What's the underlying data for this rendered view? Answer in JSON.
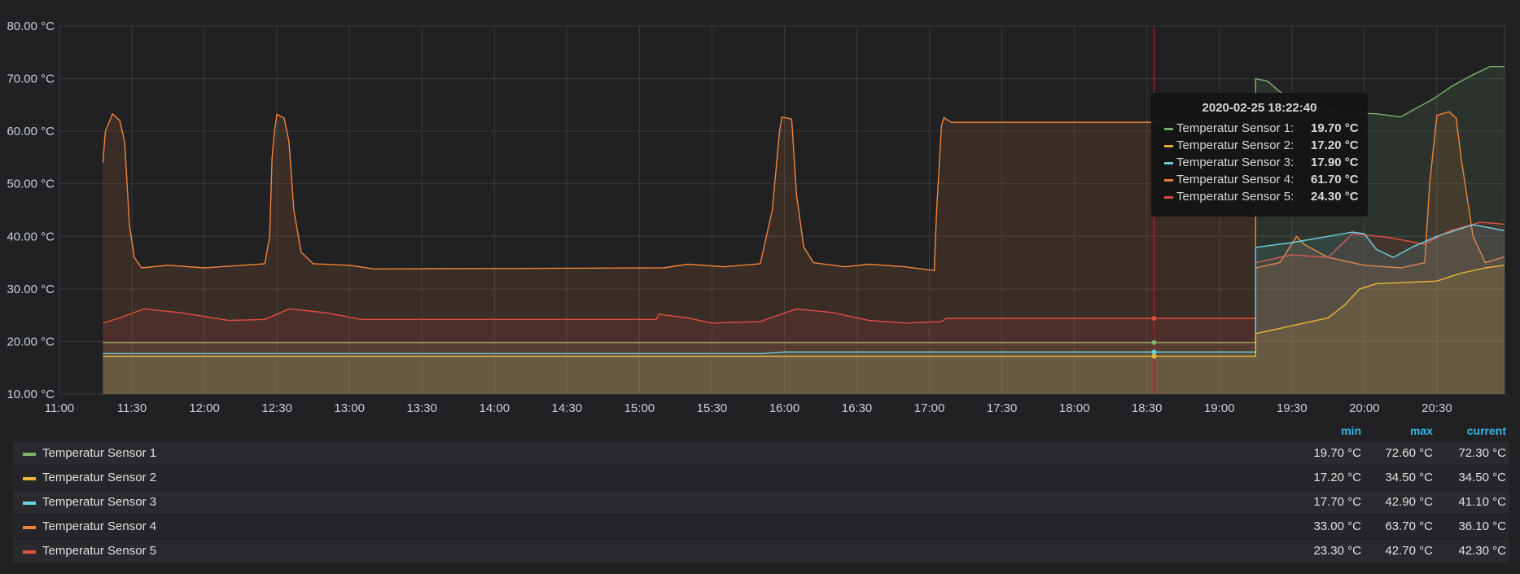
{
  "chart_data": {
    "type": "area",
    "title": "",
    "xlabel": "",
    "ylabel": "",
    "x_range": [
      "11:00",
      "20:58"
    ],
    "ylim": [
      10,
      80
    ],
    "y_ticks": [
      "80.00 °C",
      "70.00 °C",
      "60.00 °C",
      "50.00 °C",
      "40.00 °C",
      "30.00 °C",
      "20.00 °C",
      "10.00 °C"
    ],
    "x_ticks": [
      "11:00",
      "11:30",
      "12:00",
      "12:30",
      "13:00",
      "13:30",
      "14:00",
      "14:30",
      "15:00",
      "15:30",
      "16:00",
      "16:30",
      "17:00",
      "17:30",
      "18:00",
      "18:30",
      "19:00",
      "19:30",
      "20:00",
      "20:30"
    ],
    "grid": true,
    "cursor_time": "18:33",
    "series": [
      {
        "name": "Temperatur Sensor 1",
        "color": "#7eb26d",
        "points": [
          [
            "11:18",
            19.8
          ],
          [
            "19:15",
            19.8
          ],
          [
            "19:15",
            70.0
          ],
          [
            "19:20",
            69.5
          ],
          [
            "19:25",
            67.5
          ],
          [
            "19:30",
            66.0
          ],
          [
            "19:40",
            64.5
          ],
          [
            "19:50",
            63.6
          ],
          [
            "20:05",
            63.3
          ],
          [
            "20:15",
            62.7
          ],
          [
            "20:20",
            64.0
          ],
          [
            "20:28",
            66.0
          ],
          [
            "20:36",
            68.5
          ],
          [
            "20:44",
            70.5
          ],
          [
            "20:52",
            72.3
          ],
          [
            "20:58",
            72.3
          ]
        ]
      },
      {
        "name": "Temperatur Sensor 2",
        "color": "#eab839",
        "points": [
          [
            "11:18",
            17.2
          ],
          [
            "19:15",
            17.2
          ],
          [
            "19:15",
            21.5
          ],
          [
            "19:25",
            22.5
          ],
          [
            "19:35",
            23.5
          ],
          [
            "19:45",
            24.5
          ],
          [
            "19:52",
            27.0
          ],
          [
            "19:58",
            30.0
          ],
          [
            "20:05",
            31.0
          ],
          [
            "20:30",
            31.5
          ],
          [
            "20:40",
            33.0
          ],
          [
            "20:50",
            34.0
          ],
          [
            "20:58",
            34.5
          ]
        ]
      },
      {
        "name": "Temperatur Sensor 3",
        "color": "#6ed0e0",
        "points": [
          [
            "11:18",
            17.7
          ],
          [
            "15:50",
            17.7
          ],
          [
            "16:00",
            18.0
          ],
          [
            "19:15",
            18.0
          ],
          [
            "19:15",
            37.9
          ],
          [
            "19:30",
            38.8
          ],
          [
            "19:45",
            40.0
          ],
          [
            "19:55",
            40.8
          ],
          [
            "20:00",
            40.5
          ],
          [
            "20:05",
            37.5
          ],
          [
            "20:12",
            36.0
          ],
          [
            "20:20",
            38.0
          ],
          [
            "20:30",
            40.0
          ],
          [
            "20:45",
            42.2
          ],
          [
            "20:58",
            41.1
          ]
        ]
      },
      {
        "name": "Temperatur Sensor 4",
        "color": "#ef843c",
        "points": [
          [
            "11:18",
            54.0
          ],
          [
            "11:19",
            60.0
          ],
          [
            "11:22",
            63.3
          ],
          [
            "11:25",
            62.0
          ],
          [
            "11:27",
            58.0
          ],
          [
            "11:29",
            42.0
          ],
          [
            "11:31",
            36.0
          ],
          [
            "11:34",
            34.0
          ],
          [
            "11:45",
            34.5
          ],
          [
            "12:00",
            34.0
          ],
          [
            "12:25",
            34.8
          ],
          [
            "12:27",
            40.0
          ],
          [
            "12:28",
            55.0
          ],
          [
            "12:29",
            60.0
          ],
          [
            "12:30",
            63.2
          ],
          [
            "12:33",
            62.5
          ],
          [
            "12:35",
            58.0
          ],
          [
            "12:37",
            45.0
          ],
          [
            "12:40",
            37.0
          ],
          [
            "12:45",
            34.8
          ],
          [
            "13:00",
            34.5
          ],
          [
            "13:10",
            33.8
          ],
          [
            "15:10",
            34.0
          ],
          [
            "15:20",
            34.7
          ],
          [
            "15:35",
            34.2
          ],
          [
            "15:50",
            34.8
          ],
          [
            "15:55",
            45.0
          ],
          [
            "15:58",
            60.0
          ],
          [
            "15:59",
            62.7
          ],
          [
            "16:03",
            62.3
          ],
          [
            "16:05",
            48.0
          ],
          [
            "16:08",
            38.0
          ],
          [
            "16:12",
            35.0
          ],
          [
            "16:25",
            34.2
          ],
          [
            "16:35",
            34.7
          ],
          [
            "16:50",
            34.2
          ],
          [
            "17:02",
            33.5
          ],
          [
            "17:03",
            45.0
          ],
          [
            "17:05",
            61.0
          ],
          [
            "17:06",
            62.6
          ],
          [
            "17:09",
            61.7
          ],
          [
            "18:33",
            61.7
          ],
          [
            "19:15",
            61.7
          ],
          [
            "19:15",
            34.0
          ],
          [
            "19:25",
            35.0
          ],
          [
            "19:32",
            40.0
          ],
          [
            "19:35",
            38.5
          ],
          [
            "19:45",
            36.0
          ],
          [
            "20:00",
            34.5
          ],
          [
            "20:15",
            34.0
          ],
          [
            "20:25",
            35.0
          ],
          [
            "20:27",
            50.0
          ],
          [
            "20:30",
            63.0
          ],
          [
            "20:35",
            63.7
          ],
          [
            "20:38",
            62.5
          ],
          [
            "20:40",
            55.0
          ],
          [
            "20:45",
            40.0
          ],
          [
            "20:50",
            35.0
          ],
          [
            "20:58",
            36.1
          ]
        ]
      },
      {
        "name": "Temperatur Sensor 5",
        "color": "#e24d42",
        "points": [
          [
            "11:18",
            23.5
          ],
          [
            "11:25",
            24.5
          ],
          [
            "11:35",
            26.2
          ],
          [
            "11:50",
            25.5
          ],
          [
            "12:10",
            24.0
          ],
          [
            "12:25",
            24.2
          ],
          [
            "12:35",
            26.2
          ],
          [
            "12:50",
            25.5
          ],
          [
            "13:05",
            24.2
          ],
          [
            "15:07",
            24.2
          ],
          [
            "15:08",
            25.2
          ],
          [
            "15:20",
            24.5
          ],
          [
            "15:30",
            23.5
          ],
          [
            "15:50",
            23.8
          ],
          [
            "16:05",
            26.2
          ],
          [
            "16:20",
            25.5
          ],
          [
            "16:35",
            24.0
          ],
          [
            "16:50",
            23.5
          ],
          [
            "17:05",
            23.8
          ],
          [
            "17:07",
            24.4
          ],
          [
            "18:33",
            24.4
          ],
          [
            "19:15",
            24.4
          ],
          [
            "19:15",
            35.0
          ],
          [
            "19:30",
            36.5
          ],
          [
            "19:45",
            36.0
          ],
          [
            "19:55",
            40.5
          ],
          [
            "20:10",
            39.8
          ],
          [
            "20:25",
            38.5
          ],
          [
            "20:35",
            41.0
          ],
          [
            "20:48",
            42.7
          ],
          [
            "20:58",
            42.3
          ]
        ]
      }
    ]
  },
  "tooltip": {
    "title": "2020-02-25 18:22:40",
    "rows": [
      {
        "name": "Temperatur Sensor 1:",
        "value": "19.70 °C",
        "color": "#7eb26d"
      },
      {
        "name": "Temperatur Sensor 2:",
        "value": "17.20 °C",
        "color": "#eab839"
      },
      {
        "name": "Temperatur Sensor 3:",
        "value": "17.90 °C",
        "color": "#6ed0e0"
      },
      {
        "name": "Temperatur Sensor 4:",
        "value": "61.70 °C",
        "color": "#ef843c"
      },
      {
        "name": "Temperatur Sensor 5:",
        "value": "24.30 °C",
        "color": "#e24d42"
      }
    ]
  },
  "legend": {
    "headers": {
      "min": "min",
      "max": "max",
      "current": "current"
    },
    "rows": [
      {
        "name": "Temperatur Sensor 1",
        "min": "19.70 °C",
        "max": "72.60 °C",
        "current": "72.30 °C",
        "color": "#7eb26d"
      },
      {
        "name": "Temperatur Sensor 2",
        "min": "17.20 °C",
        "max": "34.50 °C",
        "current": "34.50 °C",
        "color": "#eab839"
      },
      {
        "name": "Temperatur Sensor 3",
        "min": "17.70 °C",
        "max": "42.90 °C",
        "current": "41.10 °C",
        "color": "#6ed0e0"
      },
      {
        "name": "Temperatur Sensor 4",
        "min": "33.00 °C",
        "max": "63.70 °C",
        "current": "36.10 °C",
        "color": "#ef843c"
      },
      {
        "name": "Temperatur Sensor 5",
        "min": "23.30 °C",
        "max": "42.70 °C",
        "current": "42.30 °C",
        "color": "#e24d42"
      }
    ]
  }
}
